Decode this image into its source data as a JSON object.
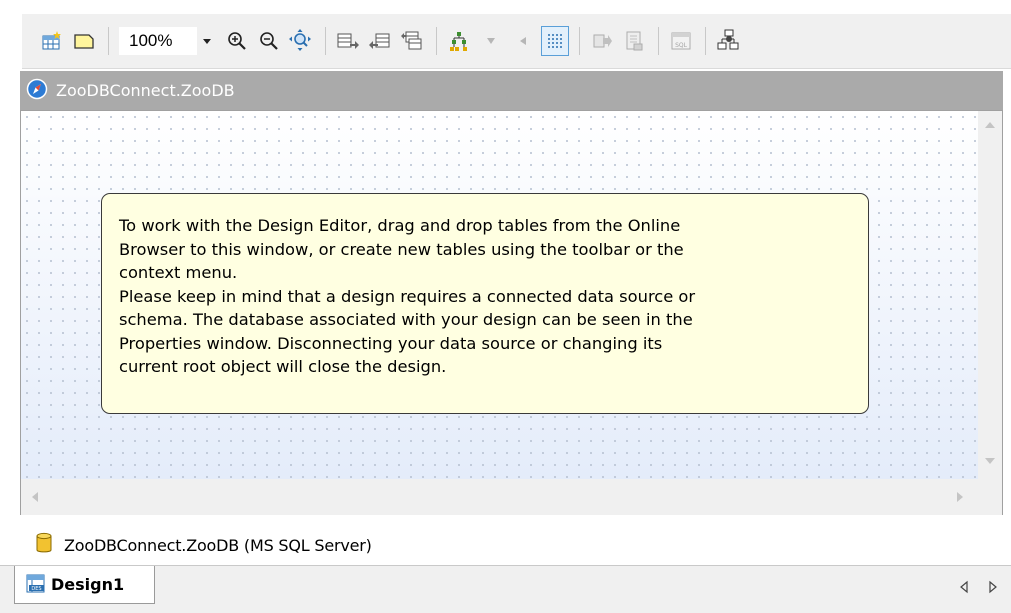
{
  "toolbar": {
    "zoom_value": "100%",
    "buttons": [
      {
        "icon": "new-table-icon"
      },
      {
        "icon": "note-icon"
      },
      {
        "icon": "zoom-in-icon"
      },
      {
        "icon": "zoom-out-icon"
      },
      {
        "icon": "zoom-fit-icon"
      },
      {
        "icon": "show-table-icon"
      },
      {
        "icon": "hide-table-icon"
      },
      {
        "icon": "related-tables-icon"
      },
      {
        "icon": "hierarchy-layout-icon"
      },
      {
        "icon": "grid-icon",
        "active": true
      },
      {
        "icon": "generate-script-icon"
      },
      {
        "icon": "execute-icon"
      },
      {
        "icon": "sql-icon"
      },
      {
        "icon": "compare-icon"
      }
    ]
  },
  "window": {
    "title": "ZooDBConnect.ZooDB"
  },
  "hint": {
    "line1": "To work with the Design Editor, drag and drop tables from the Online",
    "line2": "Browser to this window, or create new tables using the toolbar or the",
    "line3": "context menu.",
    "line4": "Please keep in mind that a design requires a connected data source or",
    "line5": "schema. The database associated with your design can be seen in the",
    "line6": "Properties window. Disconnecting your data source or changing its",
    "line7": "current root object will close the design."
  },
  "status": {
    "datasource": "ZooDBConnect.ZooDB (MS SQL Server)"
  },
  "tabs": [
    {
      "label": "Design1",
      "active": true
    }
  ],
  "colors": {
    "accent": "#5a9fd8",
    "titlebar": "#aaaaaa",
    "hint_background": "#ffffe1",
    "database_icon": "#f2c230"
  }
}
